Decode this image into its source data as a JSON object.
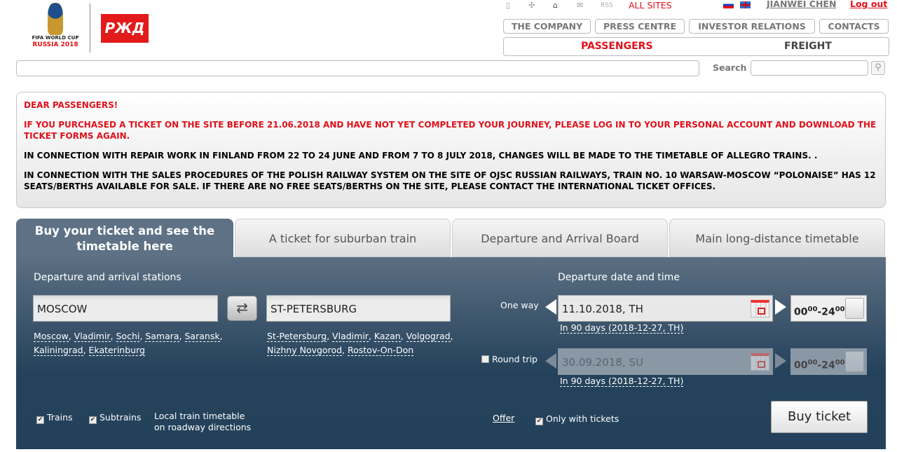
{
  "logos": {
    "fifa": "FIFA WORLD CUP RUSSIA 2018",
    "rzd": "РЖД"
  },
  "topbar": {
    "icons": [
      "mobile-icon",
      "sitemap-icon",
      "home-icon",
      "mail-icon"
    ],
    "rss": "RSS",
    "all_sites": "ALL SITES",
    "user": "JIANWEI CHEN",
    "logout": "Log out"
  },
  "nav": {
    "items": [
      "THE COMPANY",
      "PRESS CENTRE",
      "INVESTOR RELATIONS",
      "CONTACTS"
    ],
    "passengers": "PASSENGERS",
    "freight": "FREIGHT"
  },
  "search": {
    "label": "Search",
    "value": ""
  },
  "notice": {
    "title": "DEAR PASSENGERS!",
    "p1": "IF YOU PURCHASED A TICKET ON THE SITE BEFORE 21.06.2018 AND HAVE NOT YET COMPLETED YOUR JOURNEY, PLEASE LOG IN TO YOUR PERSONAL ACCOUNT AND DOWNLOAD THE TICKET FORMS AGAIN.",
    "p2": "IN CONNECTION WITH REPAIR WORK IN FINLAND FROM 22 TO 24 JUNE AND FROM 7 TO 8 JULY 2018, CHANGES WILL BE MADE TO THE TIMETABLE OF ALLEGRO TRAINS. .",
    "p3": "IN CONNECTION WITH THE SALES PROCEDURES OF THE POLISH RAILWAY SYSTEM ON THE SITE OF OJSC RUSSIAN RAILWAYS, TRAIN NO. 10 WARSAW-MOSCOW “POLONAISE” HAS 12 SEATS/BERTHS AVAILABLE FOR SALE. IF THERE ARE NO FREE SEATS/BERTHS ON THE SITE, PLEASE CONTACT THE INTERNATIONAL TICKET OFFICES."
  },
  "tabs": [
    "Buy your ticket and see the timetable here",
    "A ticket for suburban train",
    "Departure and Arrival Board",
    "Main long-distance timetable"
  ],
  "form": {
    "stations_label": "Departure and arrival stations",
    "from": "MOSCOW",
    "to": "ST-PETERSBURG",
    "from_links": [
      "Moscow",
      "Vladimir",
      "Sochi",
      "Samara",
      "Saransk",
      "Kaliningrad",
      "Ekaterinburg"
    ],
    "to_links": [
      "St-Petersburg",
      "Vladimir",
      "Kazan",
      "Volgograd",
      "Nizhny Novgorod",
      "Rostov-On-Don"
    ],
    "date_label": "Departure date and time",
    "one_way": "One way",
    "one_way_date": "11.10.2018, TH",
    "one_way_hint": "In 90 days (2018-12-27, TH)",
    "round_trip": "Round trip",
    "round_trip_checked": false,
    "round_trip_date": "30.09.2018, SU",
    "round_trip_hint": "In 90 days (2018-12-27, TH)",
    "time_from": "00",
    "time_from_sup": "00",
    "time_to": "-24",
    "time_to_sup": "00",
    "trains": "Trains",
    "trains_checked": true,
    "subtrains": "Subtrains",
    "subtrains_checked": true,
    "local": "Local train timetable",
    "local2": "on roadway directions",
    "offer": "Offer",
    "only_tickets": "Only with tickets",
    "only_tickets_checked": true,
    "buy": "Buy ticket"
  },
  "colors": {
    "accent": "#e0111b",
    "panel_top": "#5c6f82",
    "panel_bottom": "#23415a"
  }
}
